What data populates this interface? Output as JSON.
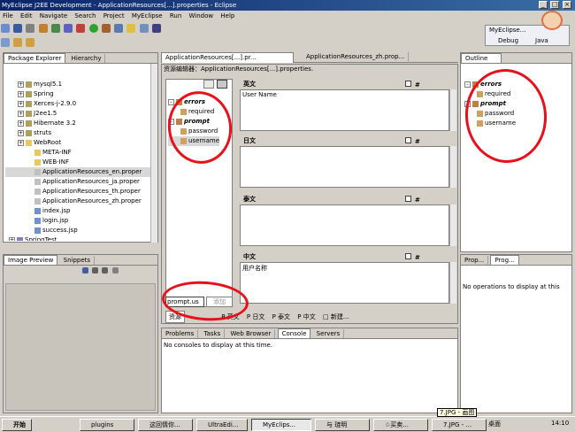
{
  "window": {
    "title": "MyEclipse J2EE Development - ApplicationResources[...].properties - Eclipse"
  },
  "menu": [
    "File",
    "Edit",
    "Navigate",
    "Search",
    "Project",
    "MyEclipse",
    "Run",
    "Window",
    "Help"
  ],
  "perspectives": [
    "MyEclipse...",
    "Debug",
    "Java"
  ],
  "package_explorer": {
    "tabs": [
      "Package Explorer",
      "Hierarchy"
    ],
    "items": [
      {
        "label": "mysql5.1",
        "level": 1,
        "icon": "library-icon"
      },
      {
        "label": "Spring",
        "level": 1,
        "icon": "library-icon"
      },
      {
        "label": "Xerces-j-2.9.0",
        "level": 1,
        "icon": "library-icon"
      },
      {
        "label": "J2ee1.5",
        "level": 1,
        "icon": "library-icon"
      },
      {
        "label": "Hibernate 3.2",
        "level": 1,
        "icon": "library-icon"
      },
      {
        "label": "struts",
        "level": 1,
        "icon": "library-icon"
      },
      {
        "label": "WebRoot",
        "level": 1,
        "icon": "folder-icon"
      },
      {
        "label": "META-INF",
        "level": 2,
        "icon": "folder-icon"
      },
      {
        "label": "WEB-INF",
        "level": 2,
        "icon": "folder-icon"
      },
      {
        "label": "ApplicationResources_en.proper",
        "level": 2,
        "icon": "file-icon"
      },
      {
        "label": "ApplicationResources_ja.proper",
        "level": 2,
        "icon": "file-icon"
      },
      {
        "label": "ApplicationResources_th.proper",
        "level": 2,
        "icon": "file-icon"
      },
      {
        "label": "ApplicationResources_zh.proper",
        "level": 2,
        "icon": "file-icon"
      },
      {
        "label": "index.jsp",
        "level": 2,
        "icon": "jsp-icon"
      },
      {
        "label": "login.jsp",
        "level": 2,
        "icon": "jsp-icon"
      },
      {
        "label": "success.jsp",
        "level": 2,
        "icon": "jsp-icon"
      },
      {
        "label": "SpringTest",
        "level": 0,
        "icon": "project-icon"
      }
    ]
  },
  "image_preview": {
    "tabs": [
      "Image Preview",
      "Snippets"
    ]
  },
  "editor": {
    "tabs": [
      "ApplicationResources[...].pr...",
      "ApplicationResources_zh.prop..."
    ],
    "header": "资源编辑器：ApplicationResources[...].properties.",
    "tree": {
      "groups": [
        {
          "name": "errors",
          "children": [
            "required"
          ]
        },
        {
          "name": "prompt",
          "children": [
            "password",
            "username"
          ]
        }
      ]
    },
    "filter_value": "prompt.us",
    "filter_button": "添加",
    "segments": [
      {
        "lang": "英文",
        "value": "User Name",
        "hash": "#"
      },
      {
        "lang": "日文",
        "value": "",
        "hash": "#"
      },
      {
        "lang": "泰文",
        "value": "",
        "hash": "#"
      },
      {
        "lang": "中文",
        "value": "用户名称",
        "hash": "#"
      }
    ],
    "bottom_tabs": [
      "资源",
      "英文",
      "日文",
      "泰文",
      "中文",
      "新建..."
    ]
  },
  "outline": {
    "tab": "Outline",
    "groups": [
      {
        "name": "errors",
        "children": [
          "required"
        ]
      },
      {
        "name": "prompt",
        "children": [
          "password",
          "username"
        ]
      }
    ]
  },
  "progress": {
    "tabs": [
      "Prop...",
      "Prog..."
    ],
    "message": "No operations to display at this"
  },
  "console": {
    "tabs": [
      "Problems",
      "Tasks",
      "Web Browser",
      "Console",
      "Servers"
    ],
    "message": "No consoles to display at this time."
  },
  "taskbar": {
    "start": "开始",
    "tasks": [
      "plugins",
      "这回情你...",
      "UltraEdi...",
      "MyEclips...",
      "与 琏明",
      "☆买卖...",
      "7.JPG - ..."
    ],
    "tooltip": "7.JPG - 画图",
    "tray_desktop": "桌面",
    "clock": "14:10"
  },
  "colors": {
    "title_start": "#0a246a",
    "title_end": "#3a6ea5",
    "annotation": "#e8101a",
    "face": "#d4d0c8"
  }
}
